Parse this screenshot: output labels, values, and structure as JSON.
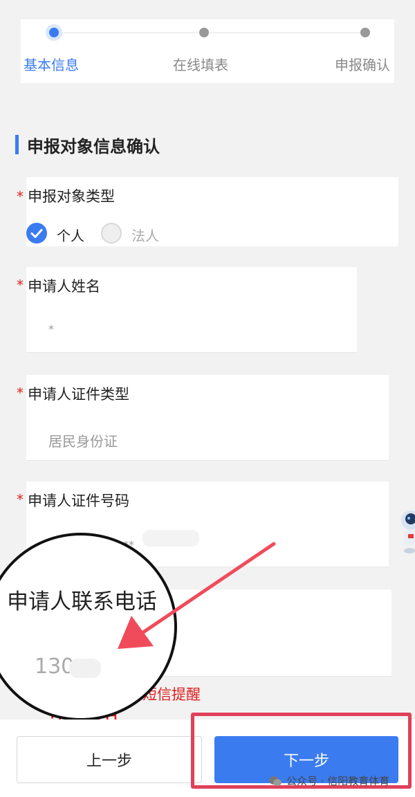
{
  "steps": [
    {
      "label": "基本信息",
      "active": true
    },
    {
      "label": "在线填表",
      "active": false
    },
    {
      "label": "申报确认",
      "active": false
    }
  ],
  "section_title": "申报对象信息确认",
  "fields": {
    "applicant_type": {
      "required_mark": "*",
      "label": "申报对象类型",
      "options": [
        {
          "label": "个人",
          "checked": true
        },
        {
          "label": "法人",
          "checked": false
        }
      ]
    },
    "applicant_name": {
      "required_mark": "*",
      "label": "申请人姓名",
      "value": "*"
    },
    "id_type": {
      "required_mark": "*",
      "label": "申请人证件类型",
      "value": "居民身份证"
    },
    "id_number": {
      "required_mark": "*",
      "label": "申请人证件号码",
      "value": "**"
    }
  },
  "sms_note": "短信提醒",
  "red_partial_text": "电话用",
  "magnifier": {
    "label": "申请人联系电话",
    "value": "130"
  },
  "buttons": {
    "prev": "上一步",
    "next": "下一步"
  },
  "watermark": "公众号 · 信阳教育体育",
  "colors": {
    "accent": "#3b7bf0",
    "required": "#e02020",
    "highlight": "#e0405a"
  }
}
